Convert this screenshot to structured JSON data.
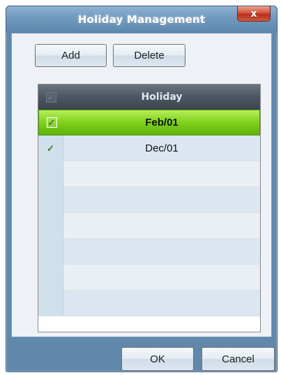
{
  "window": {
    "title": "Holiday Management",
    "close_label": "x"
  },
  "toolbar": {
    "add_label": "Add",
    "delete_label": "Delete"
  },
  "table": {
    "header_label": "Holiday",
    "rows": [
      {
        "value": "Feb/01",
        "checked": true,
        "selected": true
      },
      {
        "value": "Dec/01",
        "checked": true,
        "selected": false
      },
      {
        "value": "",
        "checked": false,
        "selected": false
      },
      {
        "value": "",
        "checked": false,
        "selected": false
      },
      {
        "value": "",
        "checked": false,
        "selected": false
      },
      {
        "value": "",
        "checked": false,
        "selected": false
      },
      {
        "value": "",
        "checked": false,
        "selected": false
      },
      {
        "value": "",
        "checked": false,
        "selected": false
      }
    ]
  },
  "footer": {
    "ok_label": "OK",
    "cancel_label": "Cancel"
  },
  "colors": {
    "selection_green": "#7fd11b",
    "header_dark": "#4c5661",
    "close_red": "#d6553c"
  }
}
